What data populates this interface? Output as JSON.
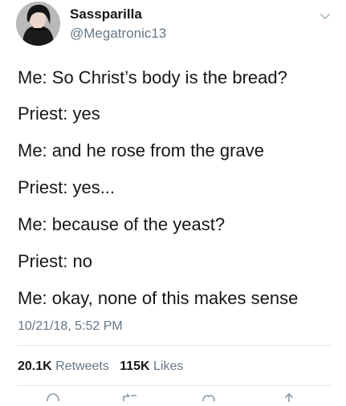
{
  "tweet": {
    "display_name": "Sassparilla",
    "handle": "@Megatronic13",
    "lines": [
      "Me: So Christ’s body is the bread?",
      "Priest: yes",
      "Me: and he rose from the grave",
      "Priest: yes...",
      "Me: because of the yeast?",
      "Priest: no",
      "Me: okay, none of this makes sense"
    ],
    "timestamp": "10/21/18, 5:52 PM",
    "stats": {
      "retweets_count": "20.1K",
      "retweets_label": "Retweets",
      "likes_count": "115K",
      "likes_label": "Likes"
    }
  },
  "icons": {
    "menu": "chevron-down-icon",
    "reply": "reply-icon",
    "retweet": "retweet-icon",
    "like": "heart-icon",
    "share": "share-icon"
  },
  "colors": {
    "text": "#14171a",
    "secondary": "#657786",
    "divider": "#e1e8ed"
  }
}
